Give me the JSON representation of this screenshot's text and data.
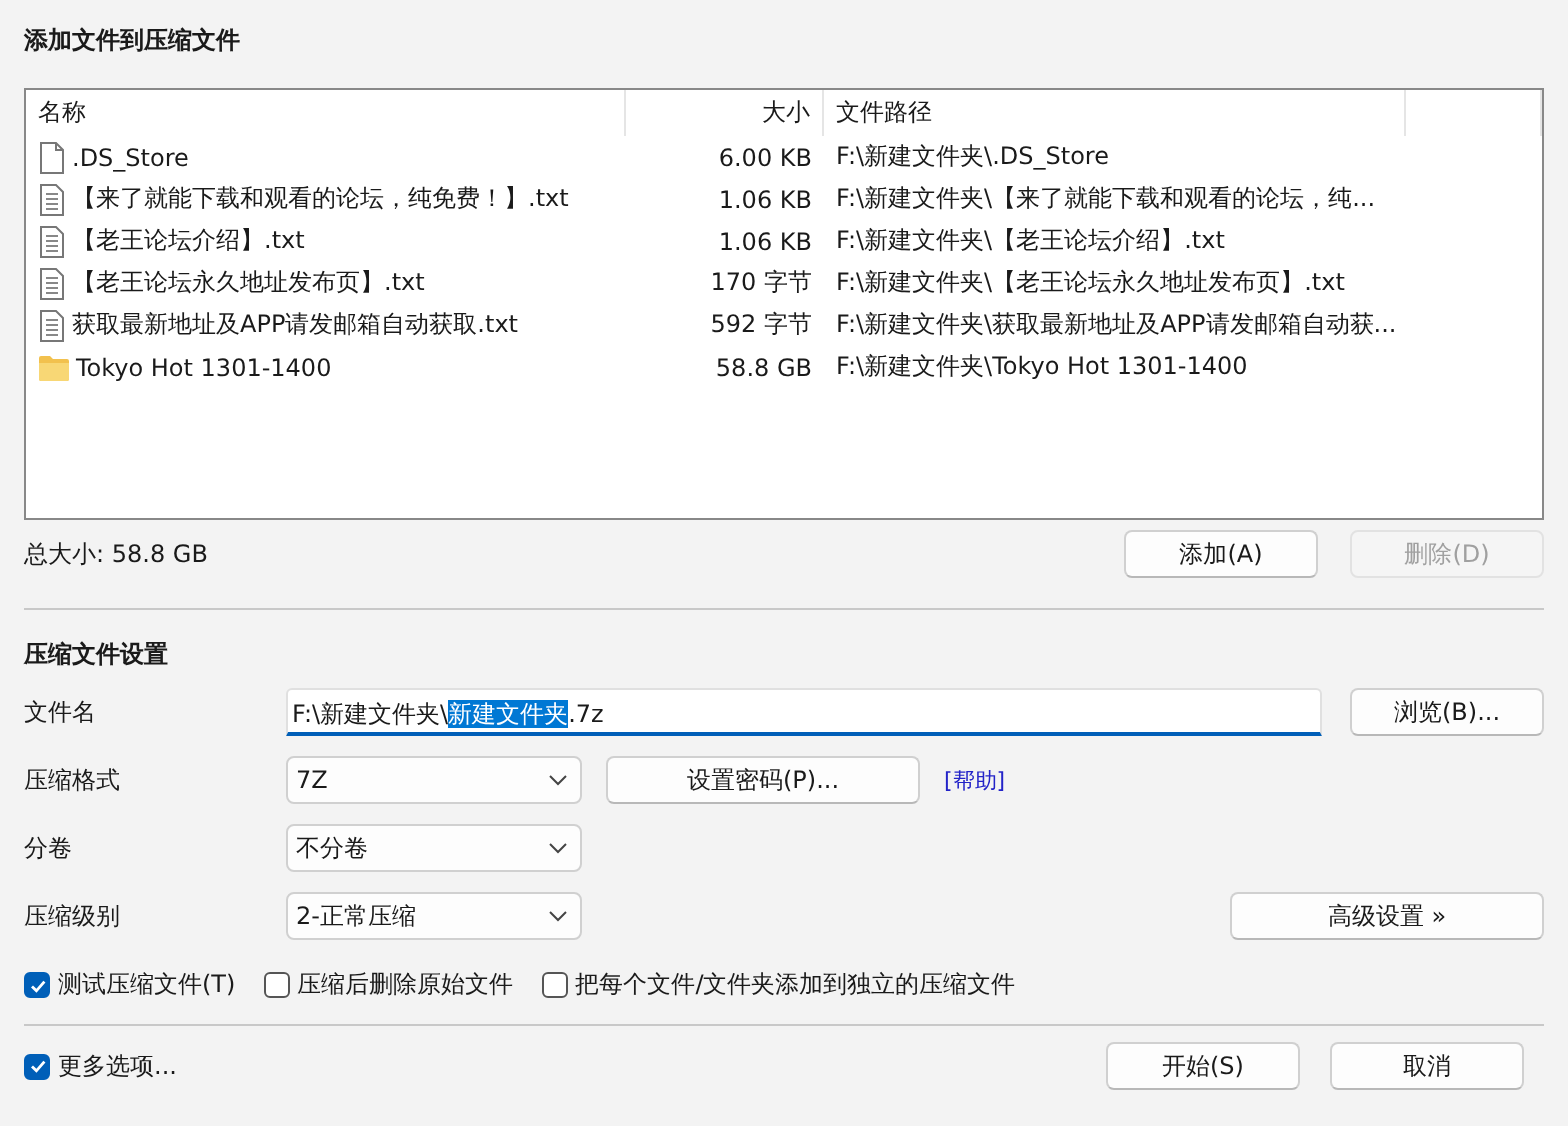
{
  "window": {
    "title": "添加文件到压缩文件"
  },
  "file_list": {
    "columns": [
      "名称",
      "大小",
      "文件路径"
    ],
    "rows": [
      {
        "kind": "file",
        "name": ".DS_Store",
        "size": "6.00 KB",
        "path": "F:\\新建文件夹\\.DS_Store"
      },
      {
        "kind": "text",
        "name": "【来了就能下载和观看的论坛，纯免费！】.txt",
        "size": "1.06 KB",
        "path": "F:\\新建文件夹\\【来了就能下载和观看的论坛，纯..."
      },
      {
        "kind": "text",
        "name": "【老王论坛介绍】.txt",
        "size": "1.06 KB",
        "path": "F:\\新建文件夹\\【老王论坛介绍】.txt"
      },
      {
        "kind": "text",
        "name": "【老王论坛永久地址发布页】.txt",
        "size": "170 字节",
        "path": "F:\\新建文件夹\\【老王论坛永久地址发布页】.txt"
      },
      {
        "kind": "text",
        "name": "获取最新地址及APP请发邮箱自动获取.txt",
        "size": "592 字节",
        "path": "F:\\新建文件夹\\获取最新地址及APP请发邮箱自动获..."
      },
      {
        "kind": "folder",
        "name": "Tokyo Hot 1301-1400",
        "size": "58.8 GB",
        "path": "F:\\新建文件夹\\Tokyo Hot 1301-1400"
      }
    ]
  },
  "total_size": "总大小: 58.8 GB",
  "list_buttons": [
    {
      "label": "添加(A)",
      "disabled": false
    },
    {
      "label": "删除(D)",
      "disabled": true
    }
  ],
  "settings": {
    "heading": "压缩文件设置",
    "filename": {
      "label": "文件名",
      "value_before": "F:\\新建文件夹\\",
      "value_selected": "新建文件夹",
      "value_after": ".7z",
      "browse": "浏览(B)..."
    },
    "format": {
      "label": "压缩格式",
      "value": "7Z",
      "password_button": "设置密码(P)...",
      "help_link": "[帮助]"
    },
    "split": {
      "label": "分卷",
      "value": "不分卷"
    },
    "level": {
      "label": "压缩级别",
      "value": "2-正常压缩",
      "advanced_button": "高级设置 »"
    },
    "options": [
      {
        "label": "测试压缩文件(T)",
        "checked": true
      },
      {
        "label": "压缩后删除原始文件",
        "checked": false
      },
      {
        "label": "把每个文件/文件夹添加到独立的压缩文件",
        "checked": false
      }
    ]
  },
  "more_options": {
    "label": "更多选项...",
    "checked": true
  },
  "buttons": [
    "开始(S)",
    "取消"
  ]
}
